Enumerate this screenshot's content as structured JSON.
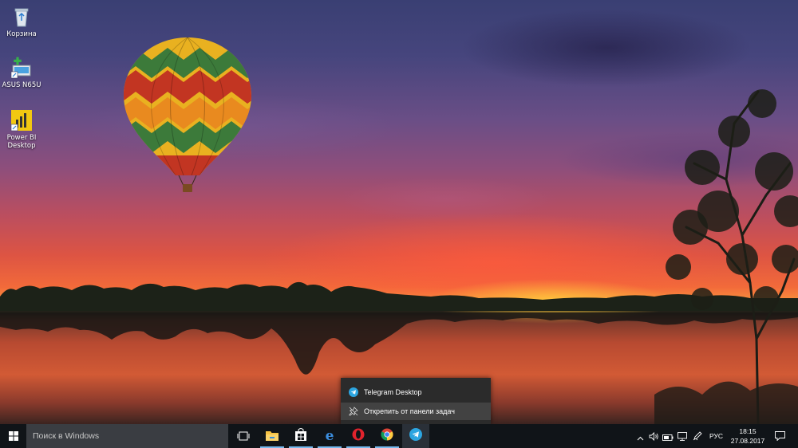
{
  "desktop": {
    "icons": [
      {
        "label": "Корзина",
        "icon": "recycle-bin-icon"
      },
      {
        "label": "ASUS N65U",
        "icon": "computer-icon"
      },
      {
        "label": "Power BI Desktop",
        "icon": "power-bi-icon"
      }
    ]
  },
  "jumplist": {
    "app_label": "Telegram Desktop",
    "unpin_label": "Открепить от панели задач"
  },
  "taskbar": {
    "search_placeholder": "Поиск в Windows",
    "pinned": [
      "task-view-icon",
      "file-explorer-icon",
      "store-icon",
      "edge-icon",
      "opera-icon",
      "chrome-icon",
      "telegram-icon"
    ],
    "tray": {
      "language": "РУС",
      "time": "18:15",
      "date": "27.08.2017"
    }
  },
  "colors": {
    "taskbar": "#101418",
    "accent": "#76b9ed",
    "menu_bg": "#2b2b2b",
    "telegram": "#2ca5e0",
    "opera": "#e0232d"
  }
}
